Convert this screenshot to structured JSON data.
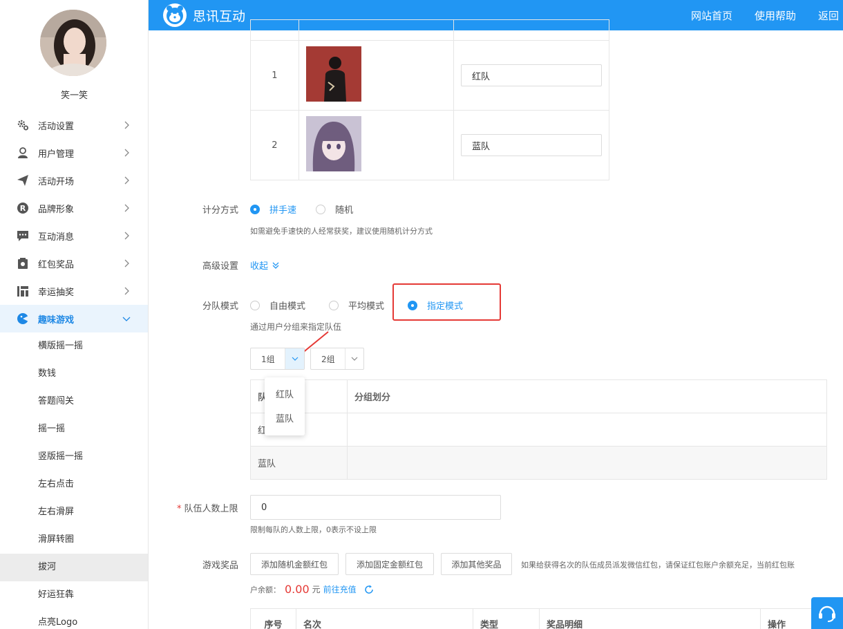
{
  "header": {
    "brand": "思讯互动",
    "nav": [
      "网站首页",
      "使用帮助",
      "返回"
    ]
  },
  "sidebar": {
    "username": "笑一笑",
    "menu": [
      {
        "label": "活动设置",
        "icon": "gear-icon"
      },
      {
        "label": "用户管理",
        "icon": "user-icon"
      },
      {
        "label": "活动开场",
        "icon": "paper-plane-icon"
      },
      {
        "label": "品牌形象",
        "icon": "registered-icon"
      },
      {
        "label": "互动消息",
        "icon": "chat-icon"
      },
      {
        "label": "红包奖品",
        "icon": "gift-icon"
      },
      {
        "label": "幸运抽奖",
        "icon": "lottery-icon"
      },
      {
        "label": "趣味游戏",
        "icon": "game-icon"
      }
    ],
    "submenu": [
      "横版摇一摇",
      "数钱",
      "答题闯关",
      "摇一摇",
      "竖版摇一摇",
      "左右点击",
      "左右滑屏",
      "滑屏转圈",
      "拔河",
      "好运狂犇",
      "点亮Logo"
    ],
    "active_submenu": "拔河"
  },
  "teams": [
    {
      "index": "1",
      "name": "红队"
    },
    {
      "index": "2",
      "name": "蓝队"
    }
  ],
  "scoring": {
    "label": "计分方式",
    "options": [
      "拼手速",
      "随机"
    ],
    "selected": "拼手速",
    "hint": "如需避免手速快的人经常获奖，建议使用随机计分方式"
  },
  "advanced": {
    "label": "高级设置",
    "toggle": "收起"
  },
  "team_mode": {
    "label": "分队模式",
    "options": [
      "自由模式",
      "平均模式",
      "指定模式"
    ],
    "selected": "指定模式",
    "hint": "通过用户分组来指定队伍"
  },
  "group_selects": [
    "1组",
    "2组"
  ],
  "dropdown_options": [
    "红队",
    "蓝队"
  ],
  "group_table": {
    "headers": [
      "队",
      "分组划分"
    ],
    "rows": [
      "红",
      "蓝队"
    ]
  },
  "team_limit": {
    "label": "队伍人数上限",
    "value": "0",
    "hint": "限制每队的人数上限，0表示不设上限"
  },
  "prizes": {
    "label": "游戏奖品",
    "buttons": [
      "添加随机金额红包",
      "添加固定金额红包",
      "添加其他奖品"
    ],
    "notice": "如果给获得名次的队伍成员派发微信红包，请保证红包账户余额充足，当前红包账",
    "balance_prefix": "户余额：",
    "balance": "0.00",
    "unit": "元",
    "recharge": "前往充值",
    "headers": [
      "序号",
      "名次",
      "类型",
      "奖品明细",
      "操作"
    ]
  },
  "colors": {
    "primary": "#2196f3",
    "danger": "#e53935"
  }
}
